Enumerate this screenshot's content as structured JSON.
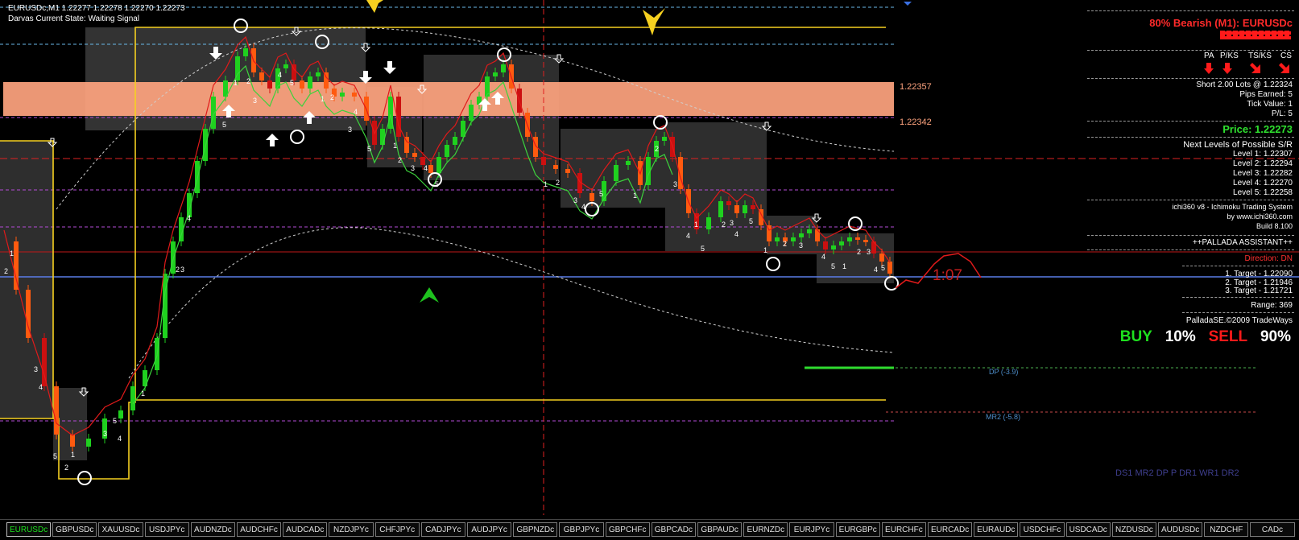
{
  "header": {
    "symbol_line": "EURUSDc,M1  1.22277 1.22278 1.22270 1.22273",
    "darvas_state": "Darvas Current State: Waiting Signal"
  },
  "price_labels": [
    "1.22357",
    "1.22342"
  ],
  "timer": "1:07",
  "box_numbers": [
    "1",
    "2",
    "3",
    "4",
    "5"
  ],
  "level_labels": {
    "dp": "DP (-3.9)",
    "mr2": "MR2 (-5.8)",
    "footer": "DS1 MR2 DP P DR1 WR1 DR2"
  },
  "panel": {
    "title": "80% Bearish (M1): EURUSDc",
    "signal_headers": [
      "PA",
      "P/KS",
      "TS/KS",
      "CS"
    ],
    "trade": {
      "position": "Short 2.00 Lots @ 1.22324",
      "pips": "Pips Earned: 5",
      "tick_value": "Tick Value: 1",
      "pl": "P/L: 5"
    },
    "price": "Price: 1.22273",
    "sr_title": "Next Levels of Possible S/R",
    "sr_levels": [
      "Level 1: 1.22307",
      "Level 2: 1.22294",
      "Level 3: 1.22282",
      "Level 4: 1.22270",
      "Level 5: 1.22258"
    ],
    "system": [
      "ichi360 v8 - Ichimoku Trading System",
      "by www.ichi360.com",
      "Build 8.100"
    ],
    "palladaTitle": "++PALLADA ASSISTANT++",
    "direction": "Direction: DN",
    "targets": [
      "1. Target - 1.22090",
      "2. Target - 1.21946",
      "3. Target - 1.21721"
    ],
    "range": "Range: 369",
    "copyright": "PalladaSE.©2009 TradeWays",
    "buy_label": "BUY",
    "buy_pct": "10%",
    "sell_label": "SELL",
    "sell_pct": "90%"
  },
  "colors": {
    "bull": "#1fd11f",
    "bear": "#ff5a0f",
    "bear_dark": "#cc1010",
    "zone": "#ffa47f",
    "yellow": "#f5d020"
  },
  "tabs": [
    "EURUSDc",
    "GBPUSDc",
    "XAUUSDc",
    "USDJPYc",
    "AUDNZDc",
    "AUDCHFc",
    "AUDCADc",
    "NZDJPYc",
    "CHFJPYc",
    "CADJPYc",
    "AUDJPYc",
    "GBPNZDc",
    "GBPJPYc",
    "GBPCHFc",
    "GBPCADc",
    "GBPAUDc",
    "EURNZDc",
    "EURJPYc",
    "EURGBPc",
    "EURCHFc",
    "EURCADc",
    "EURAUDc",
    "USDCHFc",
    "USDCADc",
    "NZDUSDc",
    "AUDUSDc",
    "NZDCHF",
    "CADc"
  ],
  "active_tab": "EURUSDc"
}
